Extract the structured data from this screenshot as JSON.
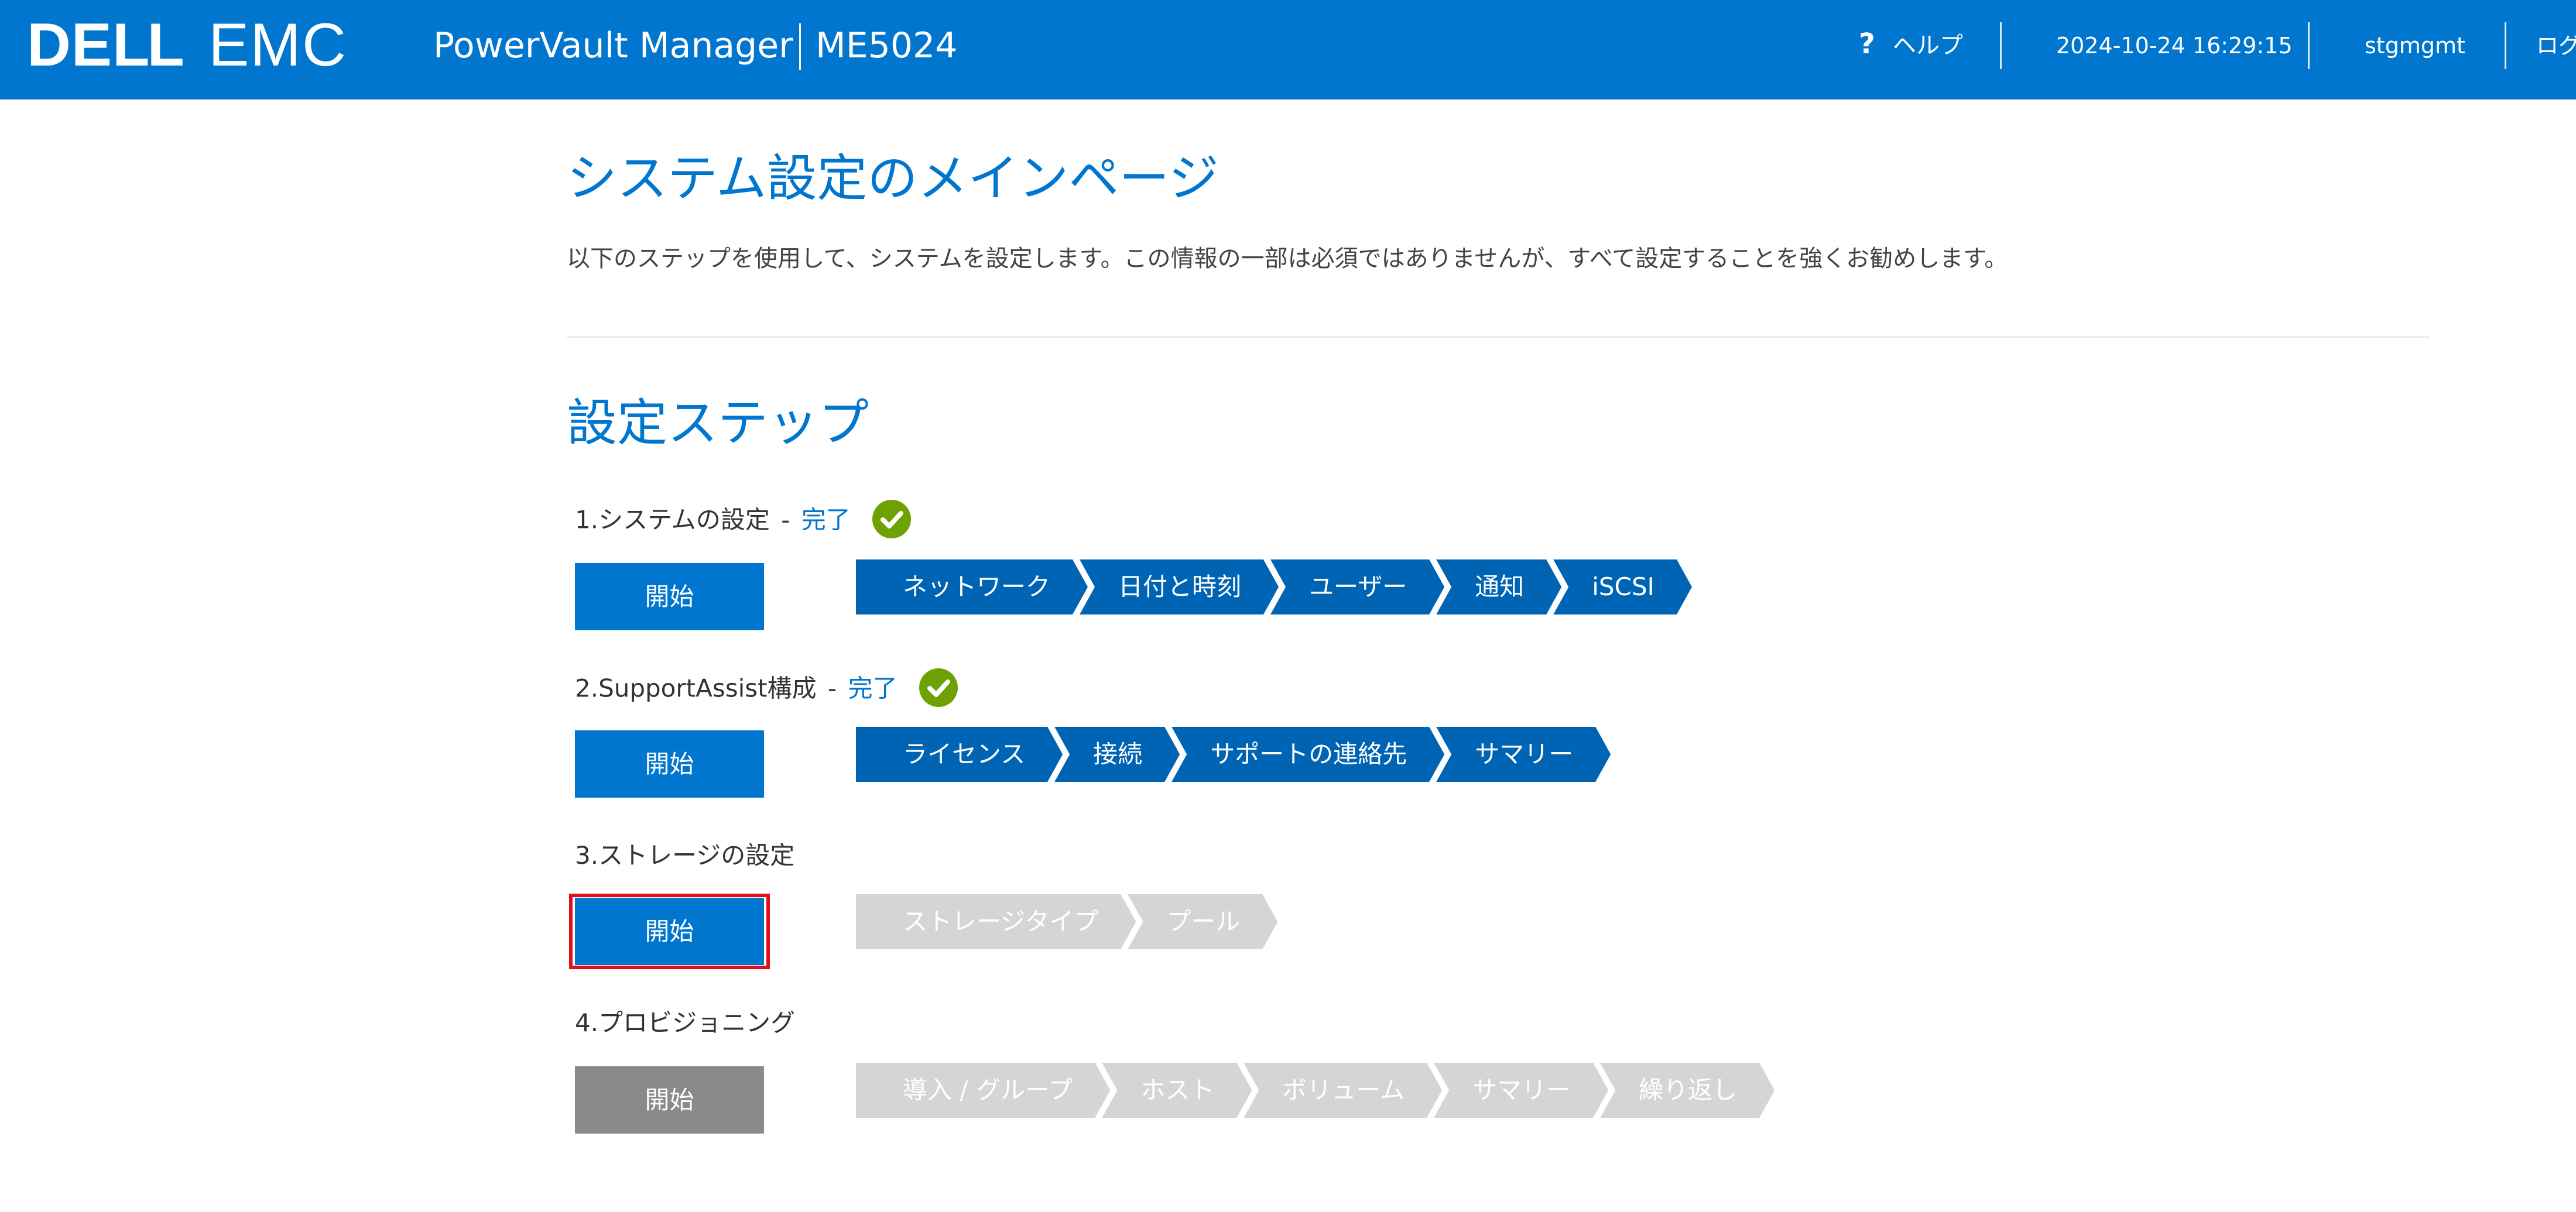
{
  "header": {
    "logo_text": "DELL EMC",
    "app_name": "PowerVault Manager",
    "model": "ME5024",
    "help_label": "ヘルプ",
    "help_glyph": "?",
    "datetime": "2024-10-24 16:29:15",
    "user": "stgmgmt",
    "logout_label": "ログ",
    "bg_color": "#0076ce"
  },
  "main": {
    "title": "システム設定のメインページ",
    "description": "以下のステップを使用して、システムを設定します。この情報の一部は必須ではありませんが、すべて設定することを強くお勧めします。",
    "section_title": "設定ステップ"
  },
  "steps": [
    {
      "label": "1.システムの設定",
      "separator": "-",
      "status": "完了",
      "completed": true,
      "button_label": "開始",
      "button_state": "enabled",
      "substeps": [
        "ネットワーク",
        "日付と時刻",
        "ユーザー",
        "通知",
        "iSCSI"
      ],
      "substeps_active": true
    },
    {
      "label": "2.SupportAssist構成",
      "separator": "-",
      "status": "完了",
      "completed": true,
      "button_label": "開始",
      "button_state": "enabled",
      "substeps": [
        "ライセンス",
        "接続",
        "サポートの連絡先",
        "サマリー"
      ],
      "substeps_active": true
    },
    {
      "label": "3.ストレージの設定",
      "status": "",
      "completed": false,
      "button_label": "開始",
      "button_state": "enabled-highlighted",
      "substeps": [
        "ストレージタイプ",
        "プール"
      ],
      "substeps_active": false
    },
    {
      "label": "4.プロビジョニング",
      "status": "",
      "completed": false,
      "button_label": "開始",
      "button_state": "disabled",
      "substeps": [
        "導入 / グループ",
        "ホスト",
        "ボリューム",
        "サマリー",
        "繰り返し"
      ],
      "substeps_active": false
    }
  ],
  "colors": {
    "accent": "#0076ce",
    "chevron_active": "#0064b4",
    "chevron_inactive": "#d5d5d5",
    "check_green": "#6ea204",
    "highlight_red": "#e0101e",
    "disabled_button": "#8a8a8a"
  }
}
